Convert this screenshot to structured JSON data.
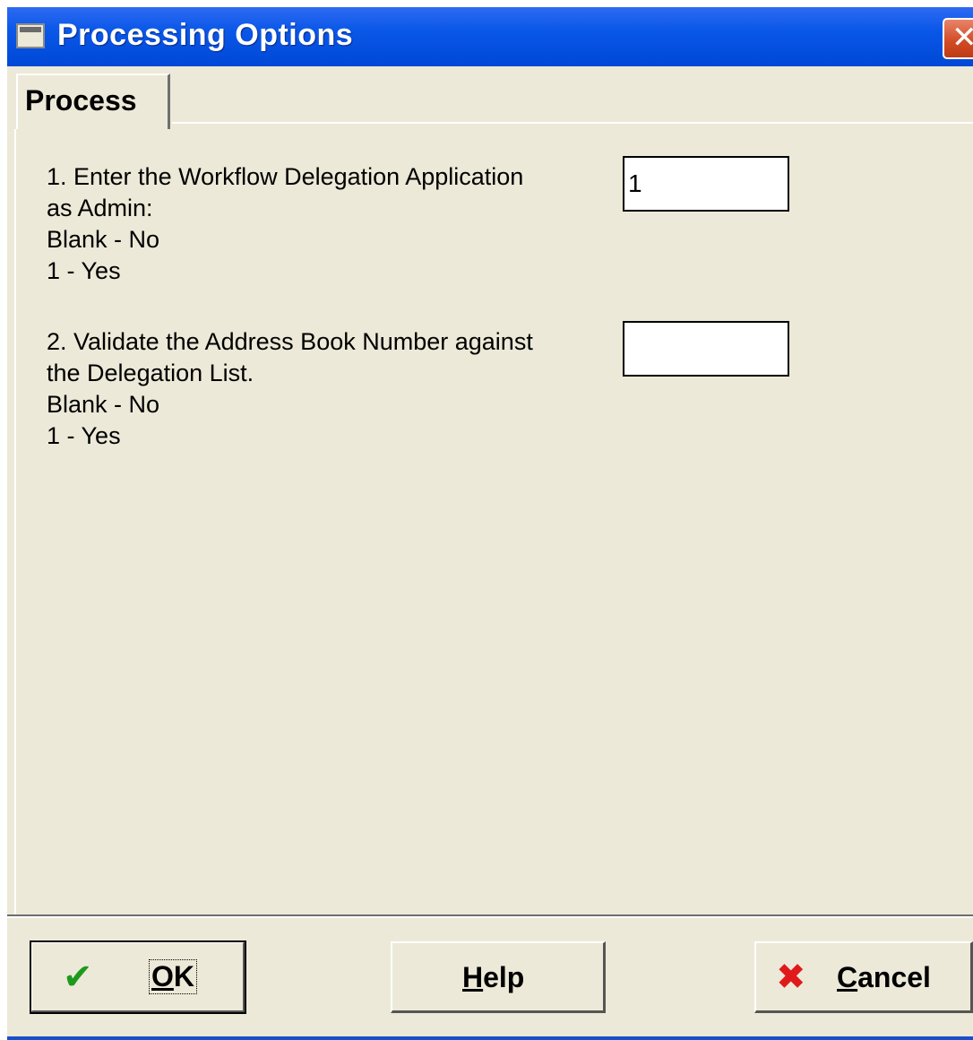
{
  "window": {
    "title": "Processing Options"
  },
  "tabs": [
    {
      "label": "Process"
    }
  ],
  "options": [
    {
      "lines": [
        "1.  Enter the Workflow Delegation Application",
        "as Admin:",
        "Blank - No",
        "1 - Yes"
      ],
      "value": "1"
    },
    {
      "lines": [
        "2.  Validate the Address Book Number against",
        "the Delegation List.",
        "Blank - No",
        "1 - Yes"
      ],
      "value": ""
    }
  ],
  "buttons": {
    "ok": {
      "label_first": "O",
      "label_rest": "K",
      "icon": "checkmark-icon"
    },
    "help": {
      "label_first": "H",
      "label_rest": "elp"
    },
    "cancel": {
      "label_first": "C",
      "label_rest": "ancel",
      "icon": "red-x-icon"
    }
  },
  "colors": {
    "titlebar": "#0a57e8",
    "dialog_bg": "#ece9d8",
    "close_button": "#d04a22",
    "ok_icon": "#1d9a1d",
    "cancel_icon": "#e01a1a"
  }
}
